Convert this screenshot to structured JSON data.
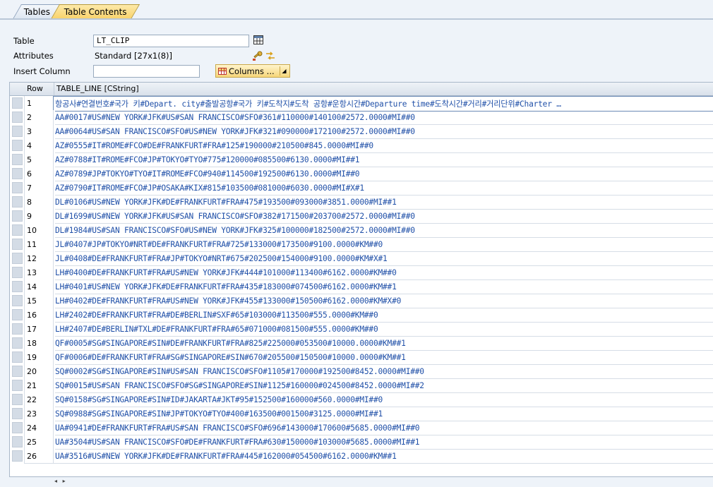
{
  "tabs": [
    {
      "label": "Tables"
    },
    {
      "label": "Table Contents"
    }
  ],
  "form": {
    "table_label": "Table",
    "table_value": "LT_CLIP",
    "attributes_label": "Attributes",
    "attributes_value": "Standard [27x1(8)]",
    "insert_column_label": "Insert Column",
    "insert_column_value": "",
    "columns_button_label": "Columns ..."
  },
  "grid": {
    "header_row": "Row",
    "header_column": "TABLE_LINE [CString]",
    "rows": [
      {
        "n": "1",
        "v": "항공사#연결번호#국가 키#Depart. city#출발공항#국가 키#도착지#도착 공항#운항시간#Departure time#도착시간#거리#거리단위#Charter …"
      },
      {
        "n": "2",
        "v": "AA#0017#US#NEW YORK#JFK#US#SAN FRANCISCO#SFO#361#110000#140100#2572.0000#MI##0"
      },
      {
        "n": "3",
        "v": "AA#0064#US#SAN FRANCISCO#SFO#US#NEW YORK#JFK#321#090000#172100#2572.0000#MI##0"
      },
      {
        "n": "4",
        "v": "AZ#0555#IT#ROME#FCO#DE#FRANKFURT#FRA#125#190000#210500#845.0000#MI##0"
      },
      {
        "n": "5",
        "v": "AZ#0788#IT#ROME#FCO#JP#TOKYO#TYO#775#120000#085500#6130.0000#MI##1"
      },
      {
        "n": "6",
        "v": "AZ#0789#JP#TOKYO#TYO#IT#ROME#FCO#940#114500#192500#6130.0000#MI##0"
      },
      {
        "n": "7",
        "v": "AZ#0790#IT#ROME#FCO#JP#OSAKA#KIX#815#103500#081000#6030.0000#MI#X#1"
      },
      {
        "n": "8",
        "v": "DL#0106#US#NEW YORK#JFK#DE#FRANKFURT#FRA#475#193500#093000#3851.0000#MI##1"
      },
      {
        "n": "9",
        "v": "DL#1699#US#NEW YORK#JFK#US#SAN FRANCISCO#SFO#382#171500#203700#2572.0000#MI##0"
      },
      {
        "n": "10",
        "v": "DL#1984#US#SAN FRANCISCO#SFO#US#NEW YORK#JFK#325#100000#182500#2572.0000#MI##0"
      },
      {
        "n": "11",
        "v": "JL#0407#JP#TOKYO#NRT#DE#FRANKFURT#FRA#725#133000#173500#9100.0000#KM##0"
      },
      {
        "n": "12",
        "v": "JL#0408#DE#FRANKFURT#FRA#JP#TOKYO#NRT#675#202500#154000#9100.0000#KM#X#1"
      },
      {
        "n": "13",
        "v": "LH#0400#DE#FRANKFURT#FRA#US#NEW YORK#JFK#444#101000#113400#6162.0000#KM##0"
      },
      {
        "n": "14",
        "v": "LH#0401#US#NEW YORK#JFK#DE#FRANKFURT#FRA#435#183000#074500#6162.0000#KM##1"
      },
      {
        "n": "15",
        "v": "LH#0402#DE#FRANKFURT#FRA#US#NEW YORK#JFK#455#133000#150500#6162.0000#KM#X#0"
      },
      {
        "n": "16",
        "v": "LH#2402#DE#FRANKFURT#FRA#DE#BERLIN#SXF#65#103000#113500#555.0000#KM##0"
      },
      {
        "n": "17",
        "v": "LH#2407#DE#BERLIN#TXL#DE#FRANKFURT#FRA#65#071000#081500#555.0000#KM##0"
      },
      {
        "n": "18",
        "v": "QF#0005#SG#SINGAPORE#SIN#DE#FRANKFURT#FRA#825#225000#053500#10000.0000#KM##1"
      },
      {
        "n": "19",
        "v": "QF#0006#DE#FRANKFURT#FRA#SG#SINGAPORE#SIN#670#205500#150500#10000.0000#KM##1"
      },
      {
        "n": "20",
        "v": "SQ#0002#SG#SINGAPORE#SIN#US#SAN FRANCISCO#SFO#1105#170000#192500#8452.0000#MI##0"
      },
      {
        "n": "21",
        "v": "SQ#0015#US#SAN FRANCISCO#SFO#SG#SINGAPORE#SIN#1125#160000#024500#8452.0000#MI##2"
      },
      {
        "n": "22",
        "v": "SQ#0158#SG#SINGAPORE#SIN#ID#JAKARTA#JKT#95#152500#160000#560.0000#MI##0"
      },
      {
        "n": "23",
        "v": "SQ#0988#SG#SINGAPORE#SIN#JP#TOKYO#TYO#400#163500#001500#3125.0000#MI##1"
      },
      {
        "n": "24",
        "v": "UA#0941#DE#FRANKFURT#FRA#US#SAN FRANCISCO#SFO#696#143000#170600#5685.0000#MI##0"
      },
      {
        "n": "25",
        "v": "UA#3504#US#SAN FRANCISCO#SFO#DE#FRANKFURT#FRA#630#150000#103000#5685.0000#MI##1"
      },
      {
        "n": "26",
        "v": "UA#3516#US#NEW YORK#JFK#DE#FRANKFURT#FRA#445#162000#054500#6162.0000#KM##1"
      }
    ]
  },
  "icons": {
    "table_picker": "table-picker-icon",
    "attr_edit": "key-icon",
    "attr_move": "arrow-flow-icon",
    "scroll_left": "◂",
    "scroll_right": "▸"
  }
}
